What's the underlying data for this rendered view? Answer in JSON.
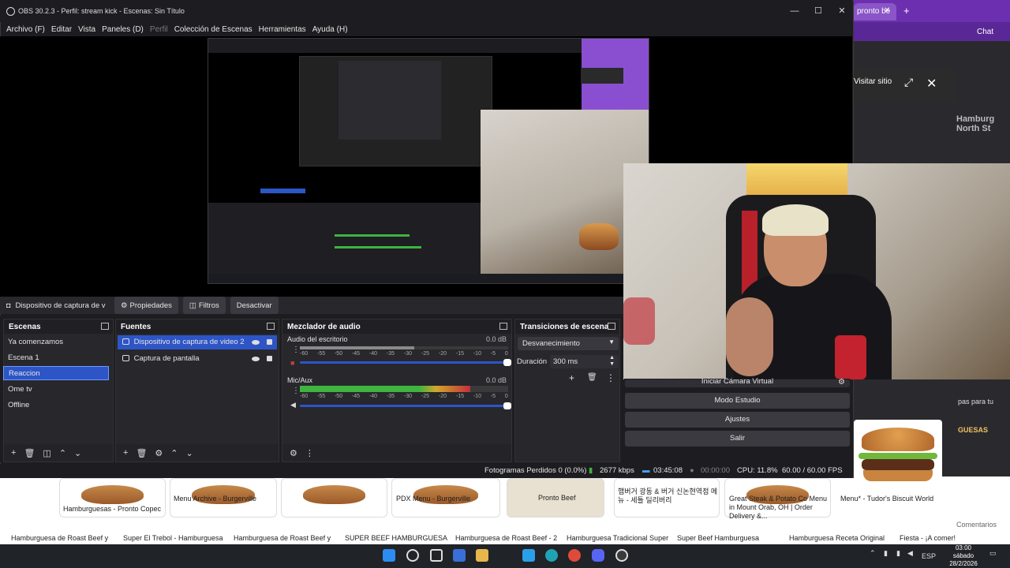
{
  "window": {
    "title": "OBS 30.2.3 - Perfil: stream kick - Escenas: Sin Título",
    "minimize": "—",
    "maximize": "☐",
    "close": "✕"
  },
  "menu": {
    "items": [
      "Archivo (F)",
      "Editar",
      "Vista",
      "Paneles (D)",
      "Perfil",
      "Colección de Escenas",
      "Herramientas",
      "Ayuda (H)"
    ]
  },
  "browser": {
    "tab_label": "pronto be",
    "chat_label": "Chat",
    "visit_site": "Visitar sitio",
    "visit_site_small": "Visitar sitio",
    "side_text_1": "Hamburg",
    "side_text_2": "North St",
    "side_text_3": "pas para tu",
    "side_text_4": "GUESAS",
    "comments": "Comentarios"
  },
  "source_toolbar": {
    "source_name": "Dispositivo de captura de v",
    "properties": "Propiedades",
    "filters": "Filtros",
    "deactivate": "Desactivar"
  },
  "scenes": {
    "title": "Escenas",
    "items": [
      "Ya comenzamos",
      "Escena 1",
      "Reaccion",
      "Ome tv",
      "Offline"
    ],
    "active_index": 2
  },
  "sources": {
    "title": "Fuentes",
    "items": [
      "Dispositivo de captura de video 2",
      "Captura de pantalla"
    ]
  },
  "mixer": {
    "title": "Mezclador de audio",
    "channels": [
      {
        "name": "Audio del escritorio",
        "db": "0.0 dB",
        "level": 0.55
      },
      {
        "name": "Mic/Aux",
        "db": "0.0 dB",
        "level": 0.82
      }
    ],
    "ticks": [
      "-60",
      "-55",
      "-50",
      "-45",
      "-40",
      "-35",
      "-30",
      "-25",
      "-20",
      "-15",
      "-10",
      "-5",
      "0"
    ]
  },
  "transitions": {
    "title": "Transiciones de escena",
    "selected": "Desvanecimiento",
    "duration_label": "Duración",
    "duration_value": "300 ms"
  },
  "controls": {
    "virtual_camera": "Iniciar Cámara Virtual",
    "studio_mode": "Modo Estudio",
    "settings": "Ajustes",
    "exit": "Salir"
  },
  "status": {
    "dropped": "Fotogramas Perdidos 0 (0.0%)",
    "bitrate": "2677 kbps",
    "stream_time": "03:45:08",
    "rec_time": "00:00:00",
    "cpu": "CPU: 11.8%",
    "fps": "60.00 / 60.00 FPS"
  },
  "results": {
    "tiles": [
      {
        "caption": "Hamburguesas - Pronto Copec"
      },
      {
        "caption": "Menu Archive - Burgerville"
      },
      {
        "caption": ""
      },
      {
        "caption": "PDX Menu - Burgerville"
      },
      {
        "caption": "Pronto Beef"
      },
      {
        "caption": "햄버거 광동 & 버거 신논현역점 메뉴 - 세틀 딜리버리"
      },
      {
        "caption": "Great Steak & Potato Co Menu in Mount Orab, OH | Order Delivery &..."
      },
      {
        "caption": "Menu* - Tudor's Biscuit World"
      }
    ],
    "footer": [
      "Hamburguesa de Roast Beef y",
      "Super El Trebol - Hamburguesa",
      "Hamburguesa de Roast Beef y",
      "SUPER BEEF HAMBURGUESA",
      "Hamburguesa de Roast Beef - 2",
      "Hamburguesa Tradicional Super",
      "Super Beef Hamburguesa",
      "Hamburguesa Receta Original",
      "Fiesta - ¡A comer!"
    ]
  },
  "taskbar": {
    "lang": "ESP",
    "time": "03:00",
    "day": "sábado",
    "date": "28/2/2026"
  }
}
